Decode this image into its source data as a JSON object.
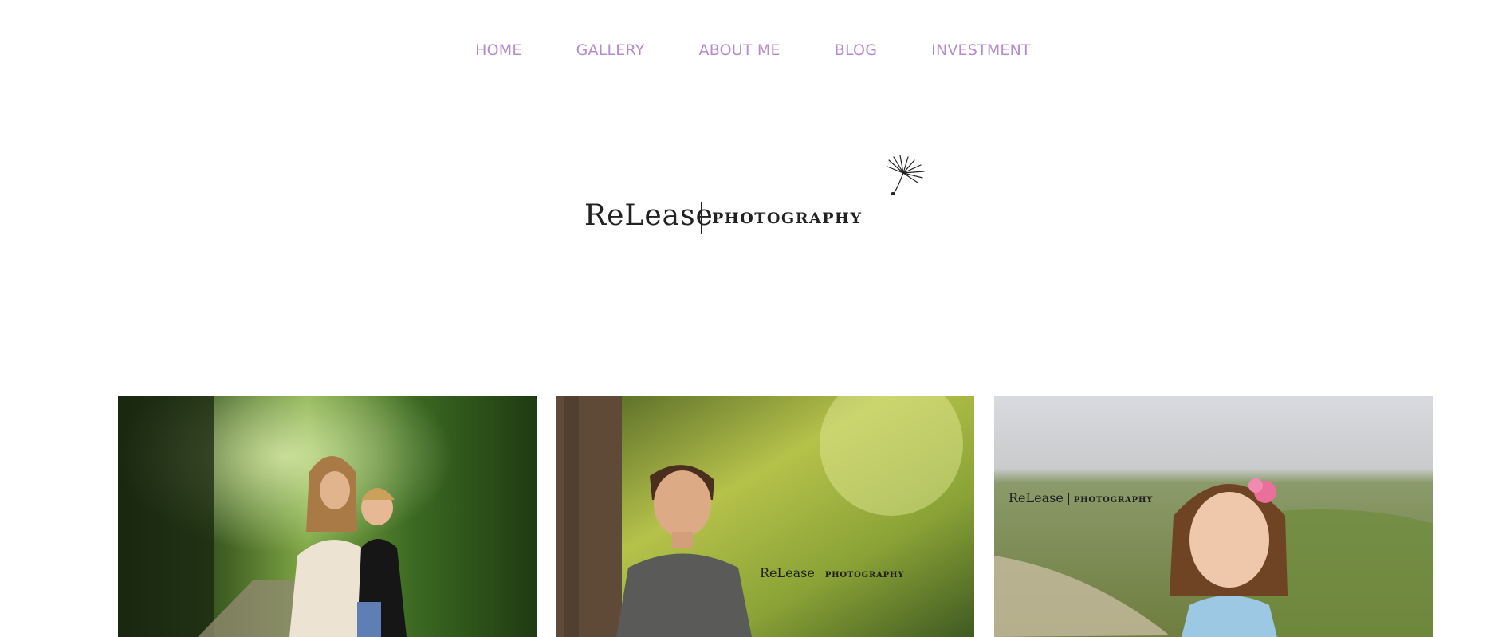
{
  "nav": {
    "items": [
      {
        "label": "HOME"
      },
      {
        "label": "GALLERY"
      },
      {
        "label": "ABOUT ME"
      },
      {
        "label": "BLOG"
      },
      {
        "label": "INVESTMENT"
      }
    ]
  },
  "logo": {
    "brand": "ReLease",
    "sub": "PHOTOGRAPHY"
  },
  "gallery": {
    "photos": [
      {
        "icon": "mother-and-child-photo"
      },
      {
        "icon": "teen-portrait-photo",
        "watermark_brand": "ReLease",
        "watermark_sub": "PHOTOGRAPHY"
      },
      {
        "icon": "girl-portrait-photo",
        "watermark_brand": "ReLease",
        "watermark_sub": "PHOTOGRAPHY"
      }
    ]
  },
  "colors": {
    "nav_text": "#b58bcb",
    "logo_text": "#222222",
    "background": "#ffffff"
  }
}
